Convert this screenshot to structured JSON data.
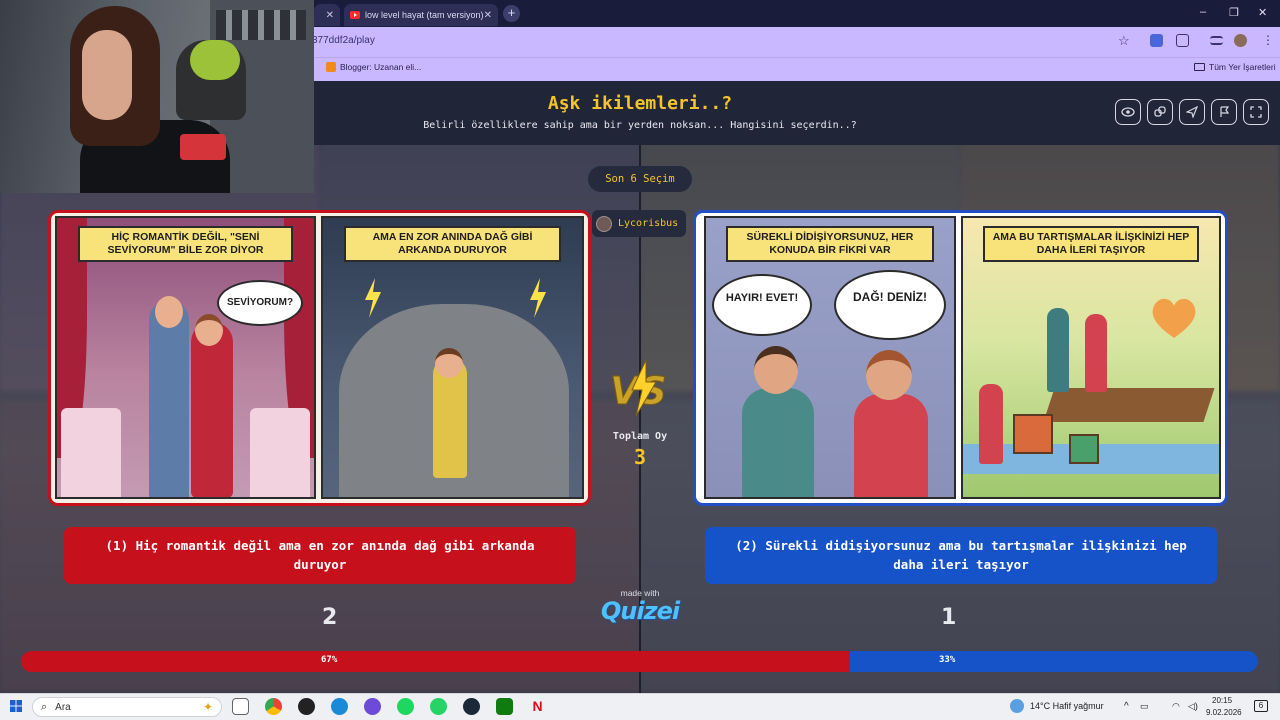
{
  "browser": {
    "tabs": [
      {
        "title": ""
      },
      {
        "title": "low level hayat (tam versiyon)"
      }
    ],
    "url": "377ddf2a/play",
    "bookmarks": [
      {
        "label": "Blogger: Uzanan eli..."
      },
      {
        "label": "Tüm Yer İşaretleri"
      }
    ],
    "window_controls": [
      "–",
      "❐",
      "✕"
    ]
  },
  "quiz": {
    "title": "Aşk ikilemleri..?",
    "subtitle": "Belirli özelliklere sahip ama bir yerden noksan... Hangisini seçerdin..?",
    "toolbar_icons": [
      "eye-icon",
      "copy-link-icon",
      "send-icon",
      "flag-icon",
      "fullscreen-icon"
    ],
    "recent_label": "Son 6 Seçim",
    "recent_user": "Lycorisbus",
    "total_label": "Toplam Oy",
    "total_votes": 3,
    "made_with": "made with",
    "brand": "Quizei",
    "options": [
      {
        "label": "(1) Hiç romantik değil ama en zor anında dağ gibi arkanda duruyor",
        "votes": 2,
        "percent": "67%",
        "color": "#c6101b",
        "panels": [
          {
            "caption": "HİÇ ROMANTİK DEĞİL, \"SENİ SEVİYORUM\" BİLE ZOR DİYOR",
            "bubble": "SEVİYORUM?"
          },
          {
            "caption": "AMA EN ZOR ANINDA DAĞ GİBİ ARKANDA DURUYOR"
          }
        ]
      },
      {
        "label": "(2) Sürekli didişiyorsunuz ama bu tartışmalar ilişkinizi hep daha ileri taşıyor",
        "votes": 1,
        "percent": "33%",
        "color": "#1753c8",
        "panels": [
          {
            "caption": "SÜREKLİ DİDİŞİYORSUNUZ, HER KONUDA BİR FİKRİ VAR",
            "bubble_left": "HAYIR! EVET!",
            "bubble_right": "DAĞ! DENİZ!"
          },
          {
            "caption": "AMA BU TARTIŞMALAR İLİŞKİNİZİ HEP DAHA İLERİ TAŞIYOR"
          }
        ]
      }
    ],
    "vote_share": 0.67
  },
  "taskbar": {
    "search_placeholder": "Ara",
    "weather": "14°C  Hafif yağmur",
    "time": "20:15",
    "date": "9.02.2026",
    "notification_count": "6"
  }
}
